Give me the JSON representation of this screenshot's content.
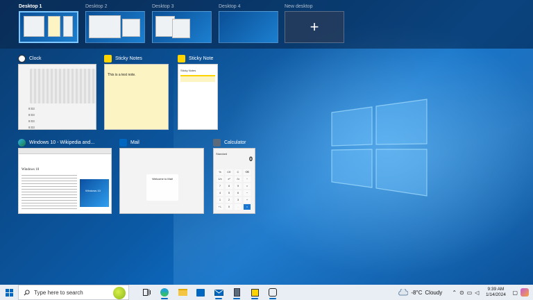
{
  "desktops": [
    {
      "label": "Desktop 1",
      "active": true
    },
    {
      "label": "Desktop 2",
      "active": false
    },
    {
      "label": "Desktop 3",
      "active": false
    },
    {
      "label": "Desktop 4",
      "active": false
    }
  ],
  "new_desktop": {
    "label": "New desktop",
    "icon": "plus-icon"
  },
  "windows": {
    "clock": {
      "title": "Clock",
      "rows": [
        "8:03",
        "8:03",
        "8:03",
        "8:03"
      ]
    },
    "sticky1": {
      "title": "Sticky Notes",
      "note_text": "This is a test note."
    },
    "sticky2": {
      "title": "Sticky Note",
      "header": "Sticky Notes"
    },
    "edge": {
      "title": "Windows 10 - Wikipedia and...",
      "page_heading": "Windows 10",
      "image_caption": "Windows 10"
    },
    "mail": {
      "title": "Mail",
      "welcome": "Welcome to Mail"
    },
    "calculator": {
      "title": "Calculator",
      "mode": "Standard",
      "display": "0",
      "keys": [
        "%",
        "CE",
        "C",
        "⌫",
        "1/x",
        "x²",
        "√x",
        "÷",
        "7",
        "8",
        "9",
        "×",
        "4",
        "5",
        "6",
        "−",
        "1",
        "2",
        "3",
        "+",
        "+/-",
        "0",
        ".",
        "="
      ]
    }
  },
  "taskbar": {
    "search_placeholder": "Type here to search",
    "weather": {
      "temp": "-8°C",
      "condition": "Cloudy"
    },
    "time": "9:39 AM",
    "date": "1/14/2024"
  },
  "colors": {
    "accent": "#0067c0",
    "active_border": "#7ec8ff"
  }
}
